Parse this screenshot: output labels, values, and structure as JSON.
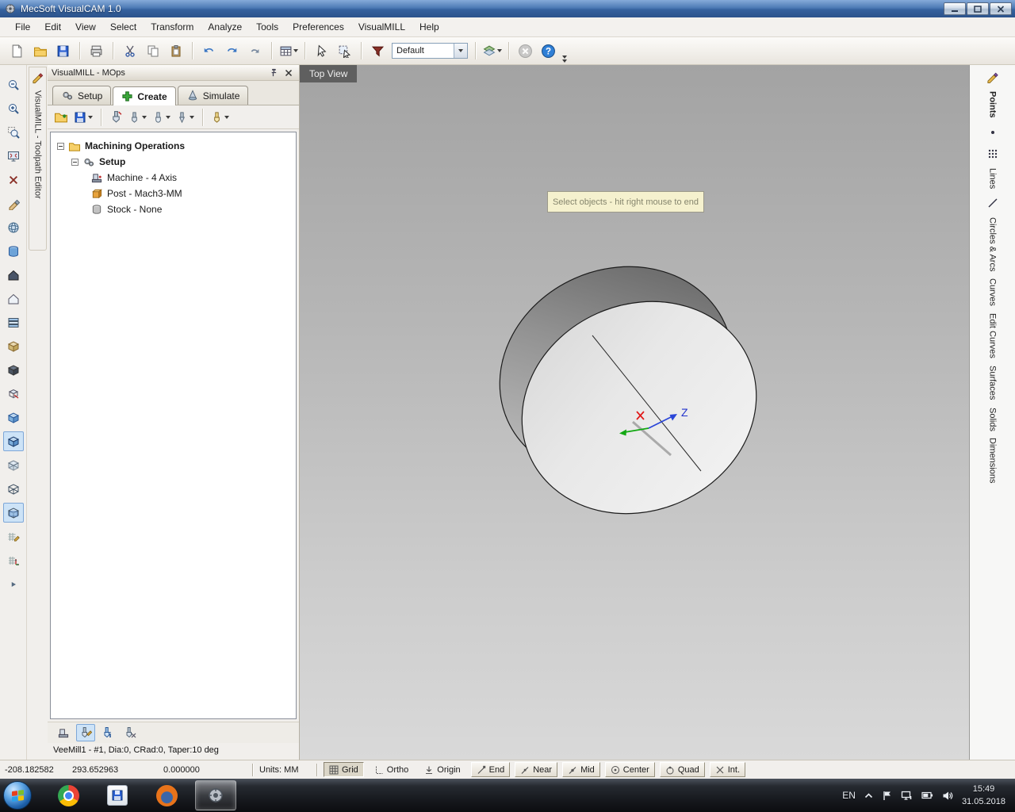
{
  "window": {
    "title": "MecSoft VisualCAM 1.0"
  },
  "menu": {
    "items": [
      "File",
      "Edit",
      "View",
      "Select",
      "Transform",
      "Analyze",
      "Tools",
      "Preferences",
      "VisualMILL",
      "Help"
    ]
  },
  "toolbar": {
    "material_combo_value": "Default"
  },
  "left_dock": {
    "vertical_label": "VisualMILL - Toolpath Editor"
  },
  "mops": {
    "title": "VisualMILL - MOps",
    "tabs": [
      {
        "label": "Setup"
      },
      {
        "label": "Create"
      },
      {
        "label": "Simulate"
      }
    ],
    "tree": {
      "root_label": "Machining Operations",
      "setup_label": "Setup",
      "children": [
        {
          "label": "Machine - 4 Axis"
        },
        {
          "label": "Post - Mach3-MM"
        },
        {
          "label": "Stock - None"
        }
      ]
    },
    "tool_status": "VeeMill1 - #1, Dia:0, CRad:0, Taper:10 deg"
  },
  "viewport": {
    "view_label": "Top View",
    "tooltip": "Select objects - hit right mouse to end",
    "axis_z_label": "Z",
    "colors": {
      "axis_x": "#e01818",
      "axis_y": "#12a812",
      "axis_z": "#2a46d8"
    }
  },
  "right_toolbar": {
    "groups": [
      "Points",
      "Lines",
      "Circles & Arcs",
      "Curves",
      "Edit Curves",
      "Surfaces",
      "Solids",
      "Dimensions"
    ]
  },
  "statusbar": {
    "coords": [
      "-208.182582",
      "293.652963",
      "0.000000"
    ],
    "units": "Units: MM",
    "snaps": [
      "Grid",
      "Ortho",
      "Origin",
      "End",
      "Near",
      "Mid",
      "Center",
      "Quad",
      "Int."
    ]
  },
  "taskbar": {
    "tray": {
      "lang": "EN",
      "time": "15:49",
      "date": "31.05.2018"
    }
  }
}
